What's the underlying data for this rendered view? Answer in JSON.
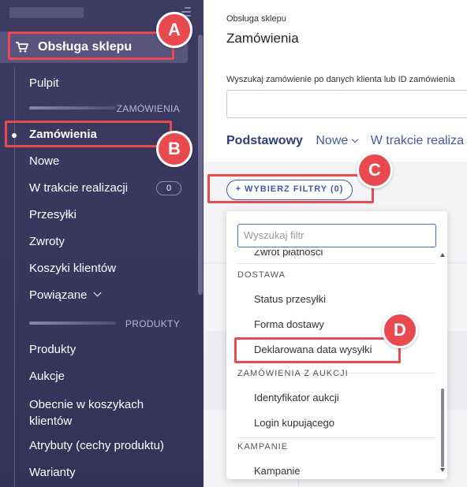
{
  "sidebar": {
    "section_title": "Obsługa sklepu",
    "items": [
      {
        "label": "Pulpit"
      },
      {
        "label": "Zamówienia"
      },
      {
        "label": "Nowe"
      },
      {
        "label": "W trakcie realizacji",
        "badge": "0"
      },
      {
        "label": "Przesyłki"
      },
      {
        "label": "Zwroty"
      },
      {
        "label": "Koszyki klientów"
      },
      {
        "label": "Powiązane"
      },
      {
        "label": "Produkty"
      },
      {
        "label": "Aukcje"
      },
      {
        "label": "Obecnie w koszykach klientów"
      },
      {
        "label": "Atrybuty (cechy produktu)"
      },
      {
        "label": "Warianty"
      }
    ],
    "groups": {
      "orders": "ZAMÓWIENIA",
      "products": "PRODUKTY"
    },
    "obecnie_line1": "Obecnie w koszykach",
    "obecnie_line2": "klientów"
  },
  "main": {
    "breadcrumb": "Obsługa sklepu",
    "title": "Zamówienia",
    "search_label": "Wyszukaj zamówienie po danych klienta lub ID zamówienia",
    "search_value": "",
    "tabs": [
      "Podstawowy",
      "Nowe",
      "W trakcie realiza"
    ],
    "filters_button": "+ WYBIERZ FILTRY (0)"
  },
  "dropdown": {
    "search_placeholder": "Wyszukaj filtr",
    "cut_item": "Zwrot płatności",
    "groups": {
      "delivery": {
        "label": "DOSTAWA",
        "items": [
          "Status przesyłki",
          "Forma dostawy",
          "Deklarowana data wysyłki"
        ]
      },
      "auction": {
        "label": "ZAMÓWIENIA Z AUKCJI",
        "items": [
          "Identyfikator aukcji",
          "Login kupującego"
        ]
      },
      "campaign": {
        "label": "KAMPANIE",
        "items": [
          "Kampanie"
        ]
      }
    }
  },
  "annotations": {
    "a": "A",
    "b": "B",
    "c": "C",
    "d": "D"
  },
  "colors": {
    "sidebar_bg": "#3e3b63",
    "accent_blue": "#3f5aa6",
    "annotation_red": "#e84a4f"
  }
}
